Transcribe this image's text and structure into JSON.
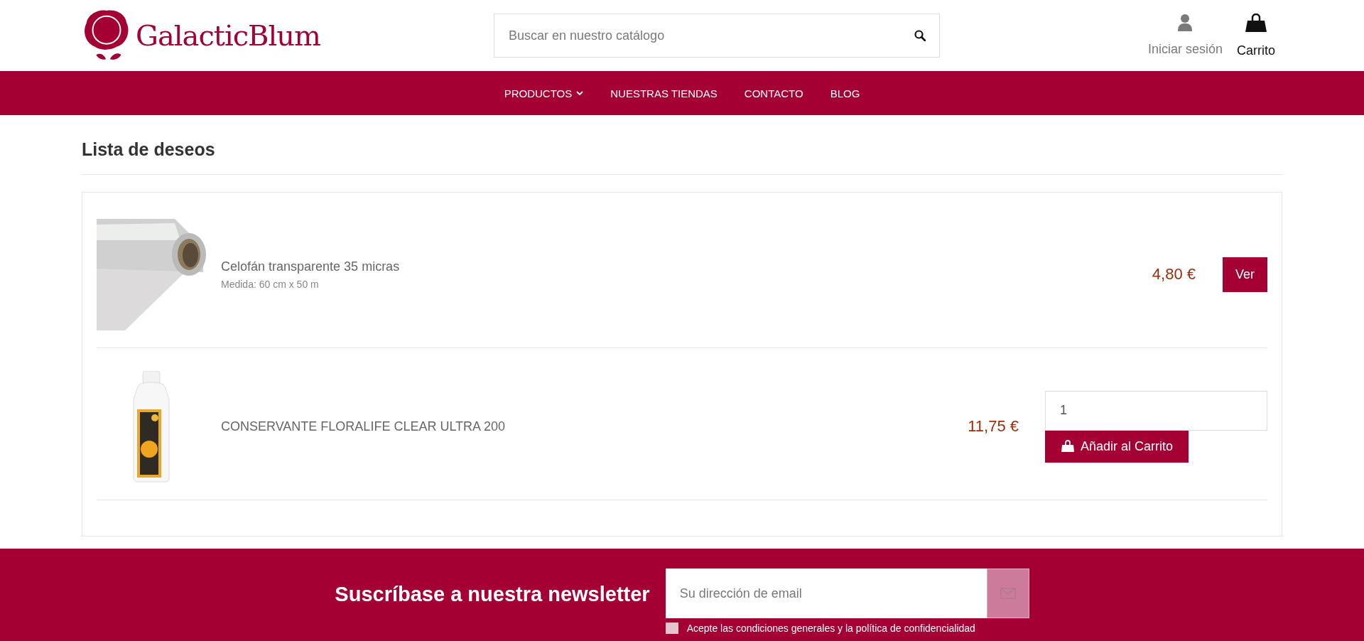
{
  "header": {
    "logo": {
      "text": "GalacticBlum"
    },
    "search": {
      "placeholder": "Buscar en nuestro catálogo"
    },
    "links": [
      {
        "kind": "user",
        "label": "Iniciar sesión",
        "selected": false
      },
      {
        "kind": "cart",
        "label": "Carrito",
        "selected": true
      }
    ]
  },
  "nav": [
    {
      "label": "PRODUCTOS",
      "dropdown": true
    },
    {
      "label": "NUESTRAS TIENDAS",
      "dropdown": false
    },
    {
      "label": "CONTACTO",
      "dropdown": false
    },
    {
      "label": "BLOG",
      "dropdown": false
    }
  ],
  "page": {
    "title": "Lista de deseos"
  },
  "wishlist": [
    {
      "kind": "view",
      "name": "Celofán transparente 35 micras",
      "attribute": "Medida: 60 cm x 50 m",
      "price": "4,80 €",
      "button": "Ver"
    },
    {
      "kind": "add",
      "name": "CONSERVANTE FLORALIFE CLEAR ULTRA 200",
      "price": "11,75 €",
      "quantity": "1",
      "button": "Añadir al Carrito"
    }
  ],
  "newsletter": {
    "title": "Suscríbase a nuestra newsletter",
    "placeholder": "Su dirección de email",
    "consent": {
      "label": "Acepte las condiciones generales y la política de confidencialidad",
      "checked": false
    }
  }
}
